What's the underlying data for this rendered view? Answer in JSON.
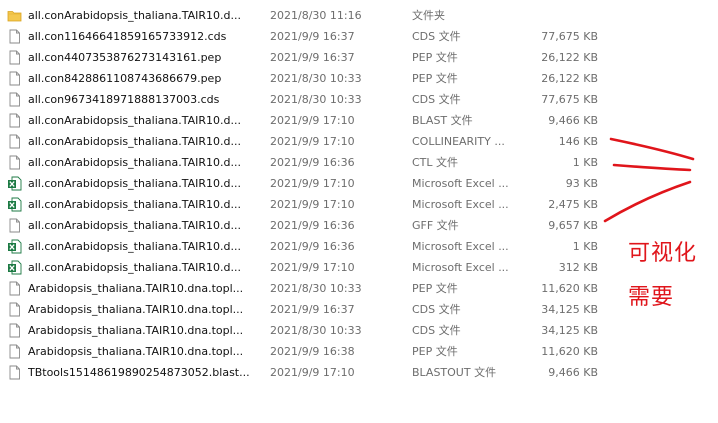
{
  "files": [
    {
      "icon": "folder-icon",
      "name": "all.conArabidopsis_thaliana.TAIR10.d...",
      "date": "2021/8/30 11:16",
      "type": "文件夹",
      "size": ""
    },
    {
      "icon": "file-icon",
      "name": "all.con1164664185916573391​2.cds",
      "date": "2021/9/9 16:37",
      "type": "CDS 文件",
      "size": "77,675 KB"
    },
    {
      "icon": "file-icon",
      "name": "all.con4407353876273143161.pep",
      "date": "2021/9/9 16:37",
      "type": "PEP 文件",
      "size": "26,122 KB"
    },
    {
      "icon": "file-icon",
      "name": "all.con8428861108743686679.pep",
      "date": "2021/8/30 10:33",
      "type": "PEP 文件",
      "size": "26,122 KB"
    },
    {
      "icon": "file-icon",
      "name": "all.con9673418971888137003.cds",
      "date": "2021/8/30 10:33",
      "type": "CDS 文件",
      "size": "77,675 KB"
    },
    {
      "icon": "file-icon",
      "name": "all.conArabidopsis_thaliana.TAIR10.d...",
      "date": "2021/9/9 17:10",
      "type": "BLAST 文件",
      "size": "9,466 KB"
    },
    {
      "icon": "file-icon",
      "name": "all.conArabidopsis_thaliana.TAIR10.d...",
      "date": "2021/9/9 17:10",
      "type": "COLLINEARITY ...",
      "size": "146 KB"
    },
    {
      "icon": "file-icon",
      "name": "all.conArabidopsis_thaliana.TAIR10.d...",
      "date": "2021/9/9 16:36",
      "type": "CTL 文件",
      "size": "1 KB"
    },
    {
      "icon": "excel-icon",
      "name": "all.conArabidopsis_thaliana.TAIR10.d...",
      "date": "2021/9/9 17:10",
      "type": "Microsoft Excel ...",
      "size": "93 KB"
    },
    {
      "icon": "excel-icon",
      "name": "all.conArabidopsis_thaliana.TAIR10.d...",
      "date": "2021/9/9 17:10",
      "type": "Microsoft Excel ...",
      "size": "2,475 KB"
    },
    {
      "icon": "file-icon",
      "name": "all.conArabidopsis_thaliana.TAIR10.d...",
      "date": "2021/9/9 16:36",
      "type": "GFF 文件",
      "size": "9,657 KB"
    },
    {
      "icon": "excel-icon",
      "name": "all.conArabidopsis_thaliana.TAIR10.d...",
      "date": "2021/9/9 16:36",
      "type": "Microsoft Excel ...",
      "size": "1 KB"
    },
    {
      "icon": "excel-icon",
      "name": "all.conArabidopsis_thaliana.TAIR10.d...",
      "date": "2021/9/9 17:10",
      "type": "Microsoft Excel ...",
      "size": "312 KB"
    },
    {
      "icon": "file-icon",
      "name": "Arabidopsis_thaliana.TAIR10.dna.topl...",
      "date": "2021/8/30 10:33",
      "type": "PEP 文件",
      "size": "11,620 KB"
    },
    {
      "icon": "file-icon",
      "name": "Arabidopsis_thaliana.TAIR10.dna.topl...",
      "date": "2021/9/9 16:37",
      "type": "CDS 文件",
      "size": "34,125 KB"
    },
    {
      "icon": "file-icon",
      "name": "Arabidopsis_thaliana.TAIR10.dna.topl...",
      "date": "2021/8/30 10:33",
      "type": "CDS 文件",
      "size": "34,125 KB"
    },
    {
      "icon": "file-icon",
      "name": "Arabidopsis_thaliana.TAIR10.dna.topl...",
      "date": "2021/9/9 16:38",
      "type": "PEP 文件",
      "size": "11,620 KB"
    },
    {
      "icon": "file-icon",
      "name": "TBtools15148619890254873052.blast...",
      "date": "2021/9/9 17:10",
      "type": "BLASTOUT 文件",
      "size": "9,466 KB"
    }
  ],
  "annotation": {
    "line1": "可视化",
    "line2": "需要"
  },
  "colors": {
    "annotation": "#e0151b",
    "folder": "#f4c84f",
    "excel": "#1d7a44"
  }
}
